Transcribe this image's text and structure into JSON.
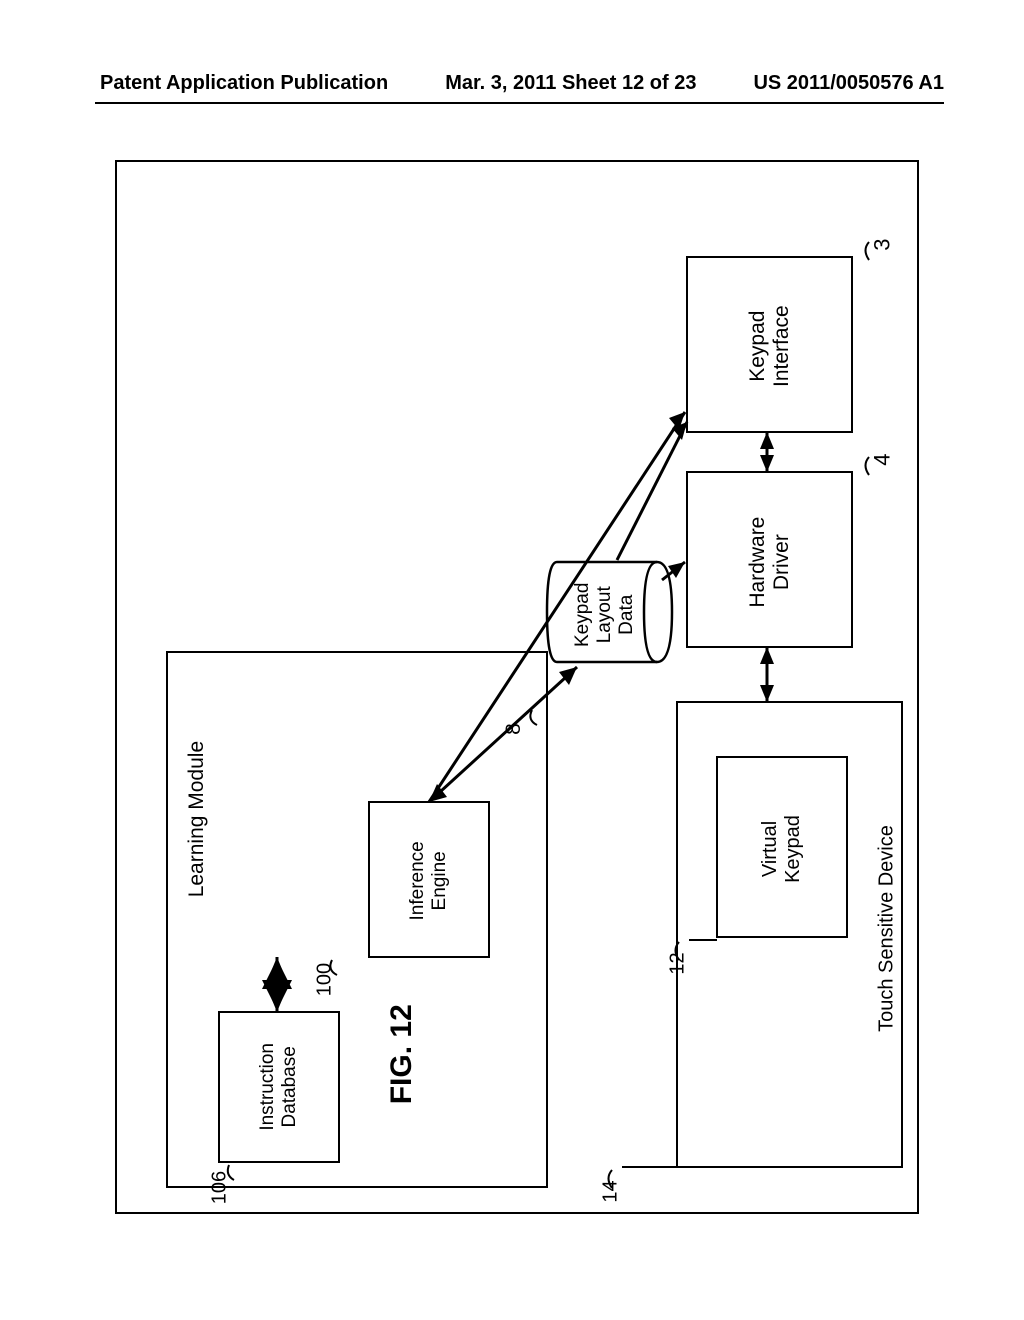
{
  "header": {
    "left": "Patent Application Publication",
    "middle": "Mar. 3, 2011  Sheet 12 of 23",
    "right": "US 2011/0050576 A1"
  },
  "labels": {
    "learning_module_label": "Learning Module",
    "touch_sensitive_label": "Touch Sensitive Device",
    "figure_caption": "FIG. 12"
  },
  "boxes": {
    "instruction_db": "Instruction\nDatabase",
    "inference_engine": "Inference\nEngine",
    "keypad_layout": "Keypad\nLayout\nData",
    "keypad_interface": "Keypad\nInterface",
    "hardware_driver": "Hardware\nDriver",
    "virtual_keypad": "Virtual\nKeypad"
  },
  "ref_numbers": {
    "instruction_db": "106",
    "inference_engine": "100",
    "keypad_layout": "8",
    "keypad_interface": "3",
    "hardware_driver": "4",
    "virtual_keypad": "12",
    "touch_sensitive": "14"
  }
}
